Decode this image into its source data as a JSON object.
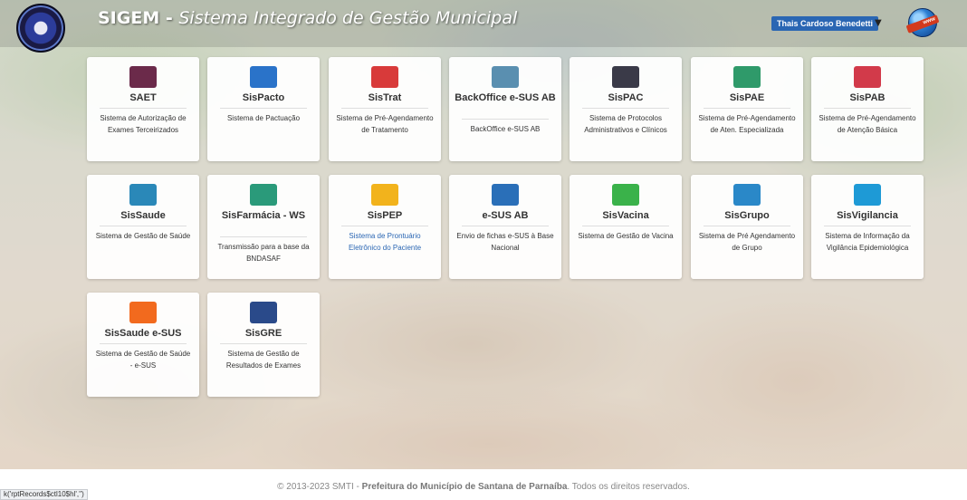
{
  "header": {
    "brand": "SIGEM",
    "separator": " - ",
    "subtitle": "Sistema Integrado de Gestão Municipal",
    "user_name": "Thais Cardoso Benedetti",
    "caret_glyph": "▼",
    "web_badge": "www"
  },
  "systems": [
    {
      "title": "SAET",
      "description": "Sistema de Autorização de Exames Terceirizados",
      "icon": "heart-monitor-icon",
      "icon_color": "#6b2a4a"
    },
    {
      "title": "SisPacto",
      "description": "Sistema de Pactuação",
      "icon": "handshake-icon",
      "icon_color": "#2a73c9"
    },
    {
      "title": "SisTrat",
      "description": "Sistema de Pré-Agendamento de Tratamento",
      "icon": "heart-hand-icon",
      "icon_color": "#d83a3a"
    },
    {
      "title": "BackOffice e-SUS AB",
      "description": "BackOffice e-SUS AB",
      "icon": "medical-clipboard-icon",
      "icon_color": "#5a8fb0"
    },
    {
      "title": "SisPAC",
      "description": "Sistema de Protocolos Administrativos e Clínicos",
      "icon": "protocol-clipboard-icon",
      "icon_color": "#3a3a48"
    },
    {
      "title": "SisPAE",
      "description": "Sistema de Pré-Agendamento de Aten. Especializada",
      "icon": "doctor-icon",
      "icon_color": "#2f9a6a"
    },
    {
      "title": "SisPAB",
      "description": "Sistema de Pré-Agendamento de Atenção Básica",
      "icon": "calendar-icon",
      "icon_color": "#d23a4a"
    },
    {
      "title": "SisSaude",
      "description": "Sistema de Gestão de Saúde",
      "icon": "growth-arrow-icon",
      "icon_color": "#2a88b8"
    },
    {
      "title": "SisFarmácia - WS",
      "description": "Transmissão para a base da BNDASAF",
      "icon": "pharmacy-shield-icon",
      "icon_color": "#2a9a7a"
    },
    {
      "title": "SisPEP",
      "description": "Sistema de Prontuário Eletrônico do Paciente",
      "icon": "clipboard-icon",
      "icon_color": "#f2b31c",
      "link": true
    },
    {
      "title": "e-SUS AB",
      "description": "Envio de fichas e-SUS à Base Nacional",
      "icon": "esus-logo-icon",
      "icon_color": "#2a6fb8"
    },
    {
      "title": "SisVacina",
      "description": "Sistema de Gestão de Vacina",
      "icon": "syringe-icon",
      "icon_color": "#3ab24a"
    },
    {
      "title": "SisGrupo",
      "description": "Sistema de Pré Agendamento de Grupo",
      "icon": "group-icon",
      "icon_color": "#2a88c8"
    },
    {
      "title": "SisVigilancia",
      "description": "Sistema de Informação da Vigilância Epidemiológica",
      "icon": "virus-icon",
      "icon_color": "#1e9ad6"
    },
    {
      "title": "SisSaude e-SUS",
      "description": "Sistema de Gestão de Saúde - e-SUS",
      "icon": "checklist-icon",
      "icon_color": "#f26a1e"
    },
    {
      "title": "SisGRE",
      "description": "Sistema de Gestão de Resultados de Exames",
      "icon": "microscope-icon",
      "icon_color": "#2a4a8a"
    }
  ],
  "footer": {
    "prefix": "© 2013-2023 SMTI - ",
    "org": "Prefeitura do Município de Santana de Parnaíba",
    "suffix": ". Todos os direitos reservados."
  },
  "status_bar": {
    "text": "k('rptRecords$ctl10$hl','')"
  }
}
